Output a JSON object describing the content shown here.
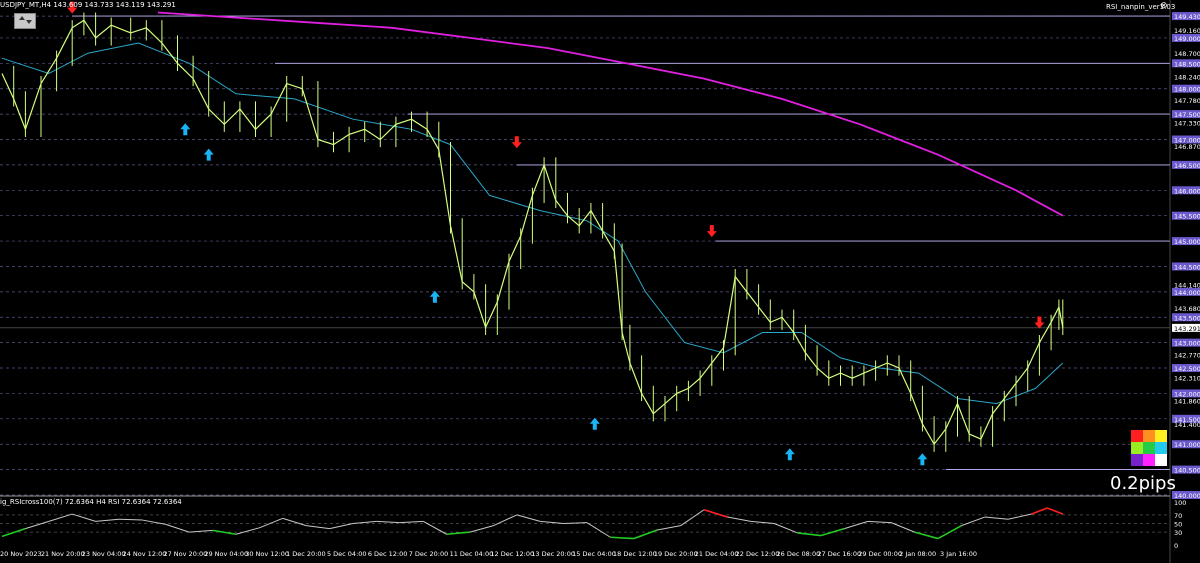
{
  "header": {
    "symbol_info": "USDJPY_MT,H4  143.609 143.733 143.119 143.291",
    "indicator_name": "RSI_nanpin_ver1.03",
    "close_glyph": "⊗"
  },
  "sub_window": {
    "label": "ig_RSIcross100(7) 72.6364  H4 RSI  72.6364 72.6364"
  },
  "overlay_text": "0.2pips",
  "colors": {
    "background": "#000000",
    "price_line": "#d4ff7f",
    "ma_fast": "#2aa7c9",
    "ma_slow": "#e020e0",
    "grid": "#5a5a8a",
    "level_line": "#c9b7ff",
    "level_label_bg": "#6a5acd",
    "arrow_up": "#18b4f5",
    "arrow_down": "#ff2020",
    "rsi_line": "#c8c8c8",
    "rsi_low": "#22cc22",
    "rsi_high": "#ff2020"
  },
  "price_axis": {
    "labels": [
      {
        "text": "149.430",
        "price": 149.43,
        "type": "level"
      },
      {
        "text": "149.160",
        "price": 149.16,
        "type": "plain"
      },
      {
        "text": "149.000",
        "price": 149.0,
        "type": "level"
      },
      {
        "text": "148.700",
        "price": 148.7,
        "type": "plain"
      },
      {
        "text": "148.500",
        "price": 148.5,
        "type": "level"
      },
      {
        "text": "148.240",
        "price": 148.24,
        "type": "plain"
      },
      {
        "text": "148.000",
        "price": 148.0,
        "type": "level"
      },
      {
        "text": "147.780",
        "price": 147.78,
        "type": "plain"
      },
      {
        "text": "147.500",
        "price": 147.5,
        "type": "level"
      },
      {
        "text": "147.330",
        "price": 147.33,
        "type": "plain"
      },
      {
        "text": "147.000",
        "price": 147.0,
        "type": "level"
      },
      {
        "text": "146.870",
        "price": 146.87,
        "type": "plain"
      },
      {
        "text": "146.500",
        "price": 146.5,
        "type": "level"
      },
      {
        "text": "146.000",
        "price": 146.0,
        "type": "level"
      },
      {
        "text": "145.500",
        "price": 145.5,
        "type": "level"
      },
      {
        "text": "145.000",
        "price": 145.0,
        "type": "level"
      },
      {
        "text": "144.500",
        "price": 144.5,
        "type": "level"
      },
      {
        "text": "144.140",
        "price": 144.14,
        "type": "plain"
      },
      {
        "text": "144.000",
        "price": 144.0,
        "type": "level"
      },
      {
        "text": "143.680",
        "price": 143.68,
        "type": "plain"
      },
      {
        "text": "143.500",
        "price": 143.5,
        "type": "level"
      },
      {
        "text": "143.291",
        "price": 143.291,
        "type": "current"
      },
      {
        "text": "143.000",
        "price": 143.0,
        "type": "level"
      },
      {
        "text": "142.770",
        "price": 142.77,
        "type": "plain"
      },
      {
        "text": "142.500",
        "price": 142.5,
        "type": "level"
      },
      {
        "text": "142.310",
        "price": 142.31,
        "type": "plain"
      },
      {
        "text": "142.000",
        "price": 142.0,
        "type": "level"
      },
      {
        "text": "141.860",
        "price": 141.86,
        "type": "plain"
      },
      {
        "text": "141.500",
        "price": 141.5,
        "type": "level"
      },
      {
        "text": "141.400",
        "price": 141.4,
        "type": "plain"
      },
      {
        "text": "141.000",
        "price": 141.0,
        "type": "level"
      },
      {
        "text": "140.500",
        "price": 140.5,
        "type": "level"
      },
      {
        "text": "140.000",
        "price": 140.0,
        "type": "level"
      }
    ]
  },
  "rsi_axis": [
    "100",
    "70",
    "50",
    "30",
    "0"
  ],
  "time_axis": [
    "20 Nov 2023",
    "21 Nov 20:00",
    "23 Nov 04:00",
    "24 Nov 12:00",
    "27 Nov 20:00",
    "29 Nov 04:00",
    "30 Nov 12:00",
    "1 Dec 20:00",
    "5 Dec 04:00",
    "6 Dec 12:00",
    "7 Dec 20:00",
    "11 Dec 04:00",
    "12 Dec 12:00",
    "13 Dec 20:00",
    "15 Dec 04:00",
    "18 Dec 12:00",
    "19 Dec 20:00",
    "21 Dec 04:00",
    "22 Dec 12:00",
    "26 Dec 08:00",
    "27 Dec 16:00",
    "29 Dec 00:00",
    "2 Jan 08:00",
    "3 Jan 16:00"
  ],
  "chart_data": {
    "type": "line",
    "symbol": "USDJPY_MT",
    "timeframe": "H4",
    "ylim": [
      140.0,
      149.55
    ],
    "price_series": [
      {
        "t": 0,
        "p": 148.3
      },
      {
        "t": 3,
        "p": 147.8
      },
      {
        "t": 6,
        "p": 147.2
      },
      {
        "t": 10,
        "p": 148.1
      },
      {
        "t": 14,
        "p": 148.6
      },
      {
        "t": 18,
        "p": 149.2
      },
      {
        "t": 21,
        "p": 149.35
      },
      {
        "t": 24,
        "p": 149.0
      },
      {
        "t": 28,
        "p": 149.25
      },
      {
        "t": 33,
        "p": 149.1
      },
      {
        "t": 37,
        "p": 149.2
      },
      {
        "t": 41,
        "p": 148.9
      },
      {
        "t": 45,
        "p": 148.5
      },
      {
        "t": 49,
        "p": 148.2
      },
      {
        "t": 53,
        "p": 147.6
      },
      {
        "t": 57,
        "p": 147.3
      },
      {
        "t": 61,
        "p": 147.6
      },
      {
        "t": 65,
        "p": 147.2
      },
      {
        "t": 69,
        "p": 147.5
      },
      {
        "t": 73,
        "p": 148.1
      },
      {
        "t": 77,
        "p": 148.0
      },
      {
        "t": 81,
        "p": 147.0
      },
      {
        "t": 85,
        "p": 146.9
      },
      {
        "t": 89,
        "p": 147.1
      },
      {
        "t": 93,
        "p": 147.2
      },
      {
        "t": 97,
        "p": 147.0
      },
      {
        "t": 101,
        "p": 147.3
      },
      {
        "t": 105,
        "p": 147.4
      },
      {
        "t": 109,
        "p": 147.2
      },
      {
        "t": 112,
        "p": 146.8
      },
      {
        "t": 115,
        "p": 145.3
      },
      {
        "t": 118,
        "p": 144.2
      },
      {
        "t": 121,
        "p": 144.0
      },
      {
        "t": 124,
        "p": 143.3
      },
      {
        "t": 127,
        "p": 143.8
      },
      {
        "t": 130,
        "p": 144.6
      },
      {
        "t": 133,
        "p": 145.1
      },
      {
        "t": 136,
        "p": 145.9
      },
      {
        "t": 139,
        "p": 146.5
      },
      {
        "t": 142,
        "p": 145.8
      },
      {
        "t": 145,
        "p": 145.5
      },
      {
        "t": 148,
        "p": 145.3
      },
      {
        "t": 151,
        "p": 145.6
      },
      {
        "t": 154,
        "p": 145.2
      },
      {
        "t": 157,
        "p": 144.8
      },
      {
        "t": 159,
        "p": 143.2
      },
      {
        "t": 161,
        "p": 142.6
      },
      {
        "t": 164,
        "p": 142.0
      },
      {
        "t": 167,
        "p": 141.6
      },
      {
        "t": 170,
        "p": 141.8
      },
      {
        "t": 173,
        "p": 142.0
      },
      {
        "t": 176,
        "p": 142.1
      },
      {
        "t": 179,
        "p": 142.3
      },
      {
        "t": 182,
        "p": 142.6
      },
      {
        "t": 185,
        "p": 142.9
      },
      {
        "t": 188,
        "p": 144.3
      },
      {
        "t": 191,
        "p": 144.0
      },
      {
        "t": 194,
        "p": 143.7
      },
      {
        "t": 197,
        "p": 143.4
      },
      {
        "t": 200,
        "p": 143.5
      },
      {
        "t": 203,
        "p": 143.2
      },
      {
        "t": 206,
        "p": 142.8
      },
      {
        "t": 209,
        "p": 142.5
      },
      {
        "t": 212,
        "p": 142.3
      },
      {
        "t": 215,
        "p": 142.4
      },
      {
        "t": 218,
        "p": 142.3
      },
      {
        "t": 221,
        "p": 142.4
      },
      {
        "t": 224,
        "p": 142.5
      },
      {
        "t": 227,
        "p": 142.6
      },
      {
        "t": 230,
        "p": 142.5
      },
      {
        "t": 233,
        "p": 142.0
      },
      {
        "t": 236,
        "p": 141.4
      },
      {
        "t": 239,
        "p": 141.0
      },
      {
        "t": 242,
        "p": 141.3
      },
      {
        "t": 245,
        "p": 141.8
      },
      {
        "t": 248,
        "p": 141.2
      },
      {
        "t": 251,
        "p": 141.1
      },
      {
        "t": 254,
        "p": 141.6
      },
      {
        "t": 257,
        "p": 141.9
      },
      {
        "t": 260,
        "p": 142.2
      },
      {
        "t": 263,
        "p": 142.5
      },
      {
        "t": 266,
        "p": 143.0
      },
      {
        "t": 269,
        "p": 143.4
      },
      {
        "t": 271,
        "p": 143.7
      },
      {
        "t": 272,
        "p": 143.3
      }
    ],
    "ma_fast": [
      {
        "t": 0,
        "p": 148.6
      },
      {
        "t": 12,
        "p": 148.3
      },
      {
        "t": 22,
        "p": 148.7
      },
      {
        "t": 35,
        "p": 148.9
      },
      {
        "t": 48,
        "p": 148.5
      },
      {
        "t": 60,
        "p": 147.9
      },
      {
        "t": 75,
        "p": 147.8
      },
      {
        "t": 90,
        "p": 147.4
      },
      {
        "t": 105,
        "p": 147.2
      },
      {
        "t": 115,
        "p": 146.9
      },
      {
        "t": 125,
        "p": 145.9
      },
      {
        "t": 138,
        "p": 145.6
      },
      {
        "t": 150,
        "p": 145.4
      },
      {
        "t": 158,
        "p": 145.0
      },
      {
        "t": 165,
        "p": 144.0
      },
      {
        "t": 175,
        "p": 143.0
      },
      {
        "t": 185,
        "p": 142.8
      },
      {
        "t": 195,
        "p": 143.2
      },
      {
        "t": 205,
        "p": 143.2
      },
      {
        "t": 215,
        "p": 142.7
      },
      {
        "t": 225,
        "p": 142.5
      },
      {
        "t": 235,
        "p": 142.4
      },
      {
        "t": 245,
        "p": 141.9
      },
      {
        "t": 255,
        "p": 141.8
      },
      {
        "t": 265,
        "p": 142.1
      },
      {
        "t": 272,
        "p": 142.6
      }
    ],
    "ma_slow": [
      {
        "t": 40,
        "p": 149.5
      },
      {
        "t": 60,
        "p": 149.4
      },
      {
        "t": 80,
        "p": 149.3
      },
      {
        "t": 100,
        "p": 149.2
      },
      {
        "t": 120,
        "p": 149.0
      },
      {
        "t": 140,
        "p": 148.8
      },
      {
        "t": 160,
        "p": 148.5
      },
      {
        "t": 180,
        "p": 148.2
      },
      {
        "t": 200,
        "p": 147.8
      },
      {
        "t": 220,
        "p": 147.3
      },
      {
        "t": 240,
        "p": 146.7
      },
      {
        "t": 260,
        "p": 146.0
      },
      {
        "t": 272,
        "p": 145.5
      }
    ],
    "levels": [
      {
        "price": 149.43,
        "t_from": 18
      },
      {
        "price": 148.5,
        "t_from": 70
      },
      {
        "price": 147.5,
        "t_from": 104
      },
      {
        "price": 146.5,
        "t_from": 132
      },
      {
        "price": 145.0,
        "t_from": 183
      },
      {
        "price": 140.5,
        "t_from": 242
      }
    ],
    "arrows_down": [
      {
        "t": 18,
        "p": 149.4
      },
      {
        "t": 132,
        "p": 146.75
      },
      {
        "t": 182,
        "p": 145.0
      },
      {
        "t": 266,
        "p": 143.2
      }
    ],
    "arrows_up": [
      {
        "t": 47,
        "p": 147.4
      },
      {
        "t": 53,
        "p": 146.9
      },
      {
        "t": 111,
        "p": 144.1
      },
      {
        "t": 152,
        "p": 141.6
      },
      {
        "t": 202,
        "p": 141.0
      },
      {
        "t": 236,
        "p": 140.9
      }
    ],
    "rsi": {
      "ylim": [
        0,
        100
      ],
      "levels": [
        70,
        50,
        30
      ],
      "values": [
        {
          "t": 0,
          "v": 20
        },
        {
          "t": 6,
          "v": 38
        },
        {
          "t": 12,
          "v": 55
        },
        {
          "t": 18,
          "v": 72
        },
        {
          "t": 24,
          "v": 55
        },
        {
          "t": 30,
          "v": 60
        },
        {
          "t": 36,
          "v": 58
        },
        {
          "t": 42,
          "v": 48
        },
        {
          "t": 48,
          "v": 30
        },
        {
          "t": 54,
          "v": 34
        },
        {
          "t": 60,
          "v": 25
        },
        {
          "t": 66,
          "v": 40
        },
        {
          "t": 72,
          "v": 62
        },
        {
          "t": 78,
          "v": 45
        },
        {
          "t": 84,
          "v": 38
        },
        {
          "t": 90,
          "v": 50
        },
        {
          "t": 96,
          "v": 55
        },
        {
          "t": 102,
          "v": 52
        },
        {
          "t": 108,
          "v": 55
        },
        {
          "t": 114,
          "v": 25
        },
        {
          "t": 120,
          "v": 30
        },
        {
          "t": 126,
          "v": 45
        },
        {
          "t": 132,
          "v": 70
        },
        {
          "t": 138,
          "v": 55
        },
        {
          "t": 144,
          "v": 50
        },
        {
          "t": 150,
          "v": 52
        },
        {
          "t": 156,
          "v": 18
        },
        {
          "t": 162,
          "v": 15
        },
        {
          "t": 168,
          "v": 35
        },
        {
          "t": 174,
          "v": 45
        },
        {
          "t": 180,
          "v": 82
        },
        {
          "t": 186,
          "v": 65
        },
        {
          "t": 192,
          "v": 55
        },
        {
          "t": 198,
          "v": 50
        },
        {
          "t": 204,
          "v": 28
        },
        {
          "t": 210,
          "v": 22
        },
        {
          "t": 216,
          "v": 38
        },
        {
          "t": 222,
          "v": 55
        },
        {
          "t": 228,
          "v": 52
        },
        {
          "t": 234,
          "v": 30
        },
        {
          "t": 240,
          "v": 15
        },
        {
          "t": 246,
          "v": 45
        },
        {
          "t": 252,
          "v": 65
        },
        {
          "t": 258,
          "v": 60
        },
        {
          "t": 264,
          "v": 72
        },
        {
          "t": 268,
          "v": 86
        },
        {
          "t": 272,
          "v": 72
        }
      ]
    }
  }
}
